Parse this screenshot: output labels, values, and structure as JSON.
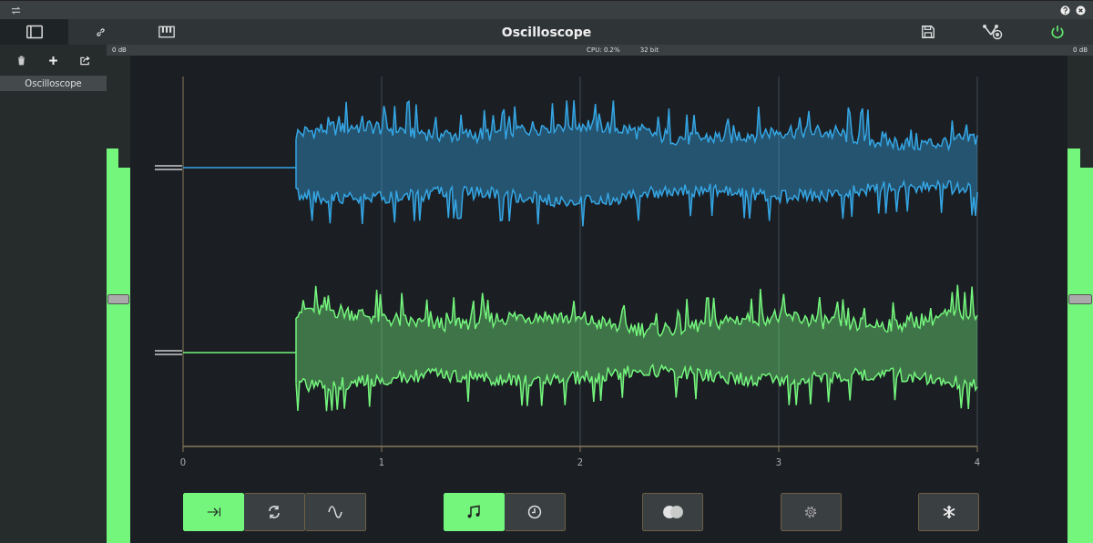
{
  "window": {
    "title": "Oscilloscope"
  },
  "tabs": [
    {
      "kind": "panel",
      "selected": true
    },
    {
      "kind": "link",
      "selected": false
    },
    {
      "kind": "piano",
      "selected": false
    }
  ],
  "sidebar": {
    "items": [
      {
        "label": "Oscilloscope",
        "selected": true
      }
    ]
  },
  "status_bar": {
    "left_level": "0 dB",
    "cpu": "CPU: 0.2%",
    "bits": "32 bit",
    "right_level": "0 dB"
  },
  "meters": [
    {
      "bars": [
        {
          "level": 0.81
        },
        {
          "level": 0.77
        }
      ],
      "slider": {
        "level": 0.5
      }
    },
    {
      "bars": [
        {
          "level": 0.81
        },
        {
          "level": 0.77
        }
      ],
      "slider": {
        "level": 0.5
      }
    }
  ],
  "channels": [
    {
      "color": "#35a6e4"
    },
    {
      "color": "#74f57c"
    }
  ],
  "x_ticks": [
    "0",
    "1",
    "2",
    "3",
    "4"
  ],
  "button_groups": [
    [
      {
        "kind": "jump-end",
        "selected": true
      },
      {
        "kind": "loop",
        "selected": false
      },
      {
        "kind": "wave",
        "selected": false
      }
    ],
    [
      {
        "kind": "note",
        "selected": true
      },
      {
        "kind": "clock",
        "selected": false
      }
    ],
    [
      {
        "kind": "circles",
        "selected": false
      }
    ],
    [
      {
        "kind": "gear",
        "selected": false
      }
    ],
    [
      {
        "kind": "snowflake",
        "selected": false
      }
    ]
  ]
}
